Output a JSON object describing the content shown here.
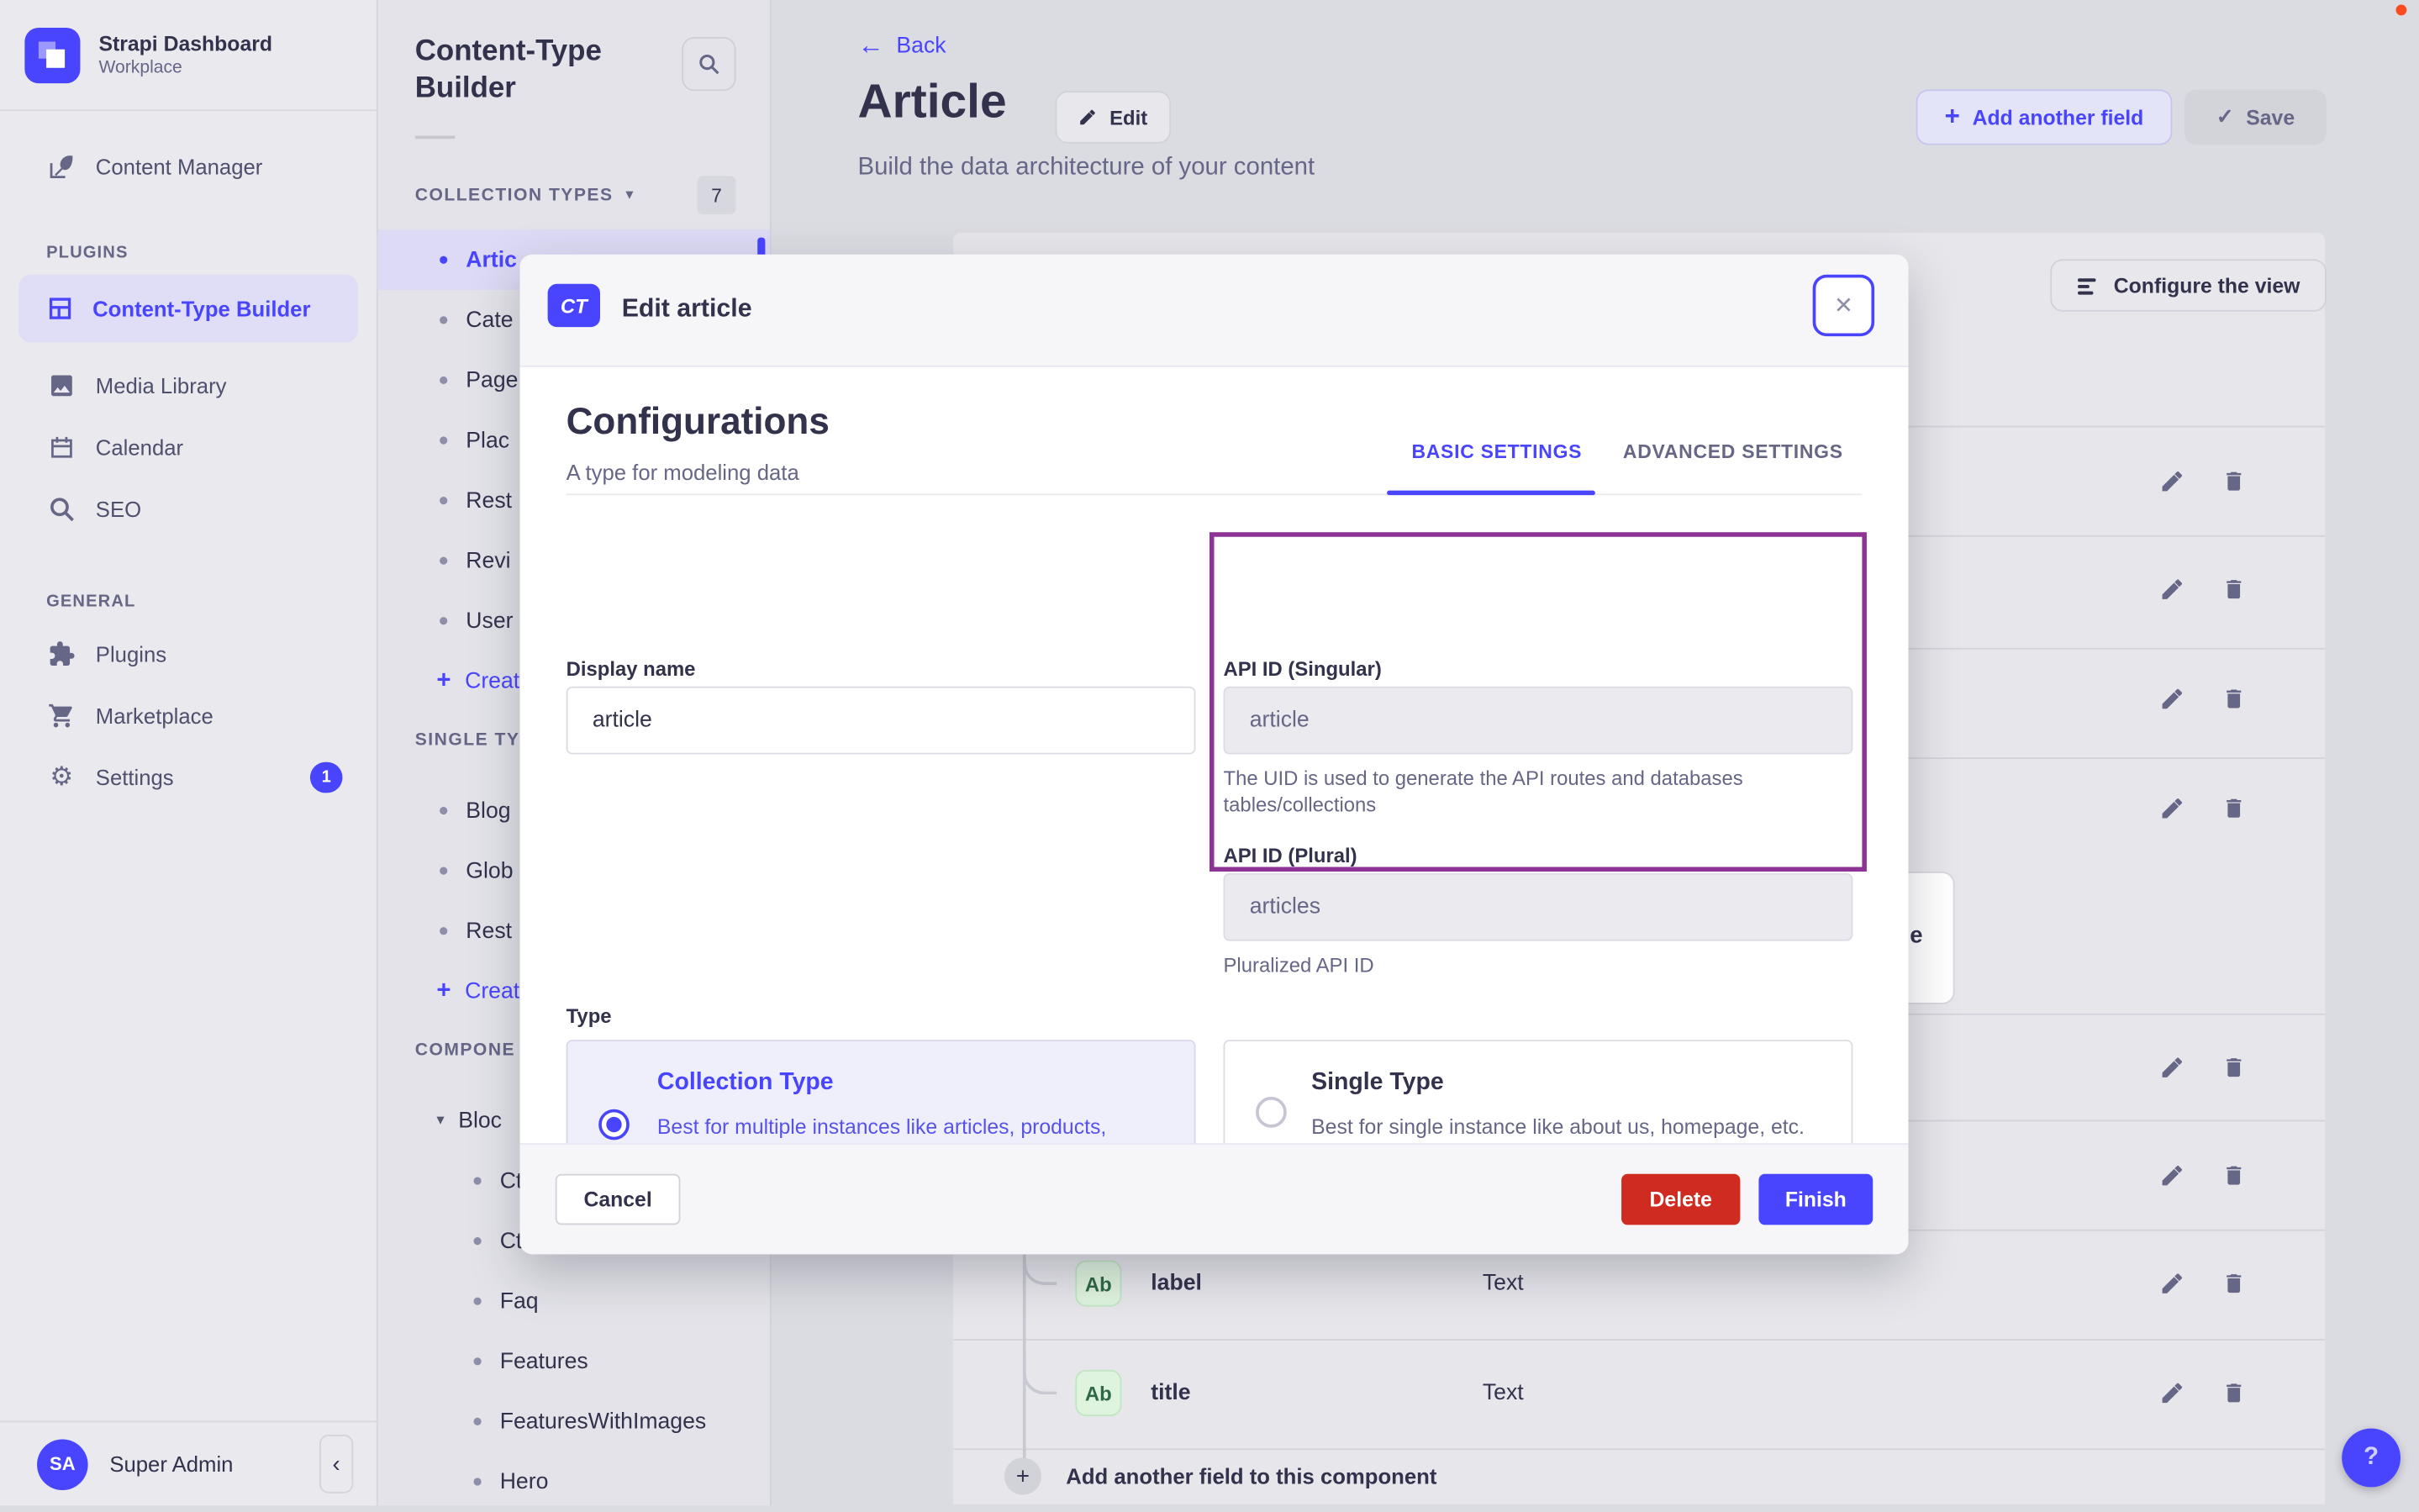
{
  "colors": {
    "primary": "#4945ff",
    "danger": "#d02b20",
    "annotation": "#8e3295",
    "save_disabled_bg": "#d3d3da"
  },
  "icons": {
    "back_arrow": "←",
    "check": "✓",
    "close": "✕",
    "collapse": "‹",
    "caret_down": "▾",
    "plus": "+",
    "question": "?",
    "gear": "⚙"
  },
  "sidebar": {
    "brand_title": "Strapi Dashboard",
    "brand_subtitle": "Workplace",
    "item_content_manager": "Content Manager",
    "section_plugins": "PLUGINS",
    "item_ctb": "Content-Type Builder",
    "item_media": "Media Library",
    "item_calendar": "Calendar",
    "item_seo": "SEO",
    "section_general": "GENERAL",
    "item_plugins": "Plugins",
    "item_marketplace": "Marketplace",
    "item_settings": "Settings",
    "settings_badge": "1",
    "user_initials": "SA",
    "user_name": "Super Admin"
  },
  "panel": {
    "title": "Content-Type Builder",
    "collection_header": "COLLECTION TYPES",
    "collection_count": "7",
    "collection_items": [
      "Artic",
      "Cate",
      "Page",
      "Plac",
      "Rest",
      "Revi",
      "User"
    ],
    "create_label": "Create",
    "single_header": "SINGLE TY",
    "single_items": [
      "Blog",
      "Glob",
      "Rest"
    ],
    "components_header": "COMPONE",
    "component_group": "Bloc",
    "component_items": [
      "Ct",
      "Ct",
      "Faq",
      "Features",
      "FeaturesWithImages",
      "Hero"
    ]
  },
  "header": {
    "back": "Back",
    "title": "Article",
    "edit": "Edit",
    "subtitle": "Build the data architecture of your content",
    "add_field": "Add another field",
    "save": "Save",
    "configure": "Configure the view"
  },
  "table": {
    "rows": [
      {
        "badge": "Ab",
        "name": "label",
        "type": "Text"
      },
      {
        "badge": "Ab",
        "name": "title",
        "type": "Text"
      }
    ],
    "add_row": "Add another field to this component",
    "fragment": "e",
    "help": "?"
  },
  "modal": {
    "badge": "CT",
    "title": "Edit article",
    "heading": "Configurations",
    "subheading": "A type for modeling data",
    "tab_basic": "BASIC SETTINGS",
    "tab_advanced": "ADVANCED SETTINGS",
    "display_name_label": "Display name",
    "display_name_value": "article",
    "api_singular_label": "API ID (Singular)",
    "api_singular_value": "article",
    "api_singular_hint": "The UID is used to generate the API routes and databases tables/collections",
    "api_plural_label": "API ID (Plural)",
    "api_plural_value": "articles",
    "api_plural_hint": "Pluralized API ID",
    "type_label": "Type",
    "collection_card": {
      "title": "Collection Type",
      "desc": "Best for multiple instances like articles, products, comments, etc."
    },
    "single_card": {
      "title": "Single Type",
      "desc": "Best for single instance like about us, homepage, etc."
    },
    "cancel": "Cancel",
    "delete": "Delete",
    "finish": "Finish"
  }
}
